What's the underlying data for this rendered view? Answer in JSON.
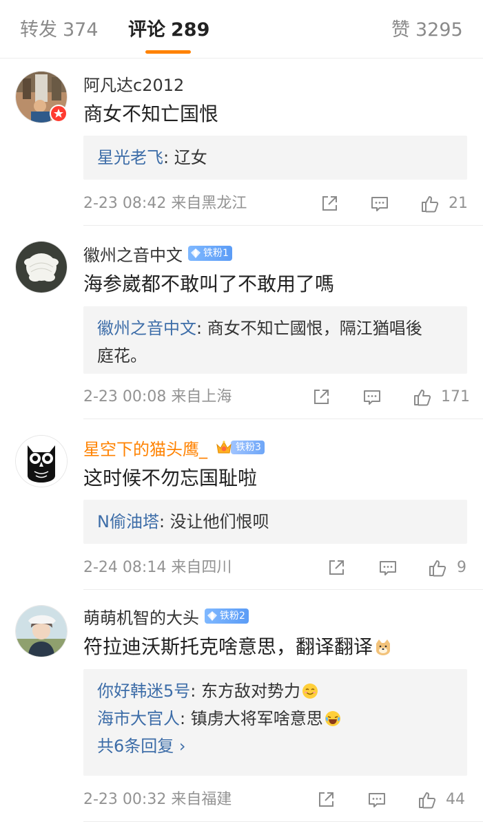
{
  "tabs": {
    "repost": {
      "label": "转发",
      "count": "374"
    },
    "comments": {
      "label": "评论",
      "count": "289"
    },
    "likes": {
      "label": "赞",
      "count": "3295"
    }
  },
  "comments": [
    {
      "username": "阿凡达c2012",
      "text": "商女不知亡国恨",
      "replies": [
        {
          "name": "星光老飞",
          "text": ": 辽女"
        }
      ],
      "time": "2-23 08:42",
      "location": "来自黑龙江",
      "likes": "21"
    },
    {
      "username": "徽州之音中文",
      "fan_badge": "铁粉1",
      "text": "海参崴都不敢叫了不敢用了嗎",
      "replies": [
        {
          "name": "徽州之音中文",
          "text": ": 商女不知亡國恨，隔江猶唱後",
          "text2": "庭花。"
        }
      ],
      "time": "2-23 00:08",
      "location": "来自上海",
      "likes": "171"
    },
    {
      "username": "星空下的猫头鹰_",
      "fan_badge": "铁粉3",
      "text": "这时候不勿忘国耻啦",
      "replies": [
        {
          "name": "N偷油塔",
          "text": ": 没让他们恨呗"
        }
      ],
      "time": "2-24 08:14",
      "location": "来自四川",
      "likes": "9"
    },
    {
      "username": "萌萌机智的大头",
      "fan_badge": "铁粉2",
      "text": "符拉迪沃斯托克啥意思，翻译翻译",
      "replies": [
        {
          "name": "你好韩迷5号",
          "text": ": 东方敌对势力"
        },
        {
          "name": "海市大官人",
          "text": ": 镇虏大将军啥意思"
        }
      ],
      "more_replies": "共6条回复 ›",
      "time": "2-23 00:32",
      "location": "来自福建",
      "likes": "44"
    }
  ],
  "colors": {
    "accent": "#ff8200",
    "link": "#3d6da8",
    "meta": "#939393",
    "reply_bg": "#f4f4f4"
  },
  "icons": [
    "share-icon",
    "comment-icon",
    "like-icon",
    "verified-badge-icon",
    "fan-gem-icon",
    "crown-icon"
  ]
}
